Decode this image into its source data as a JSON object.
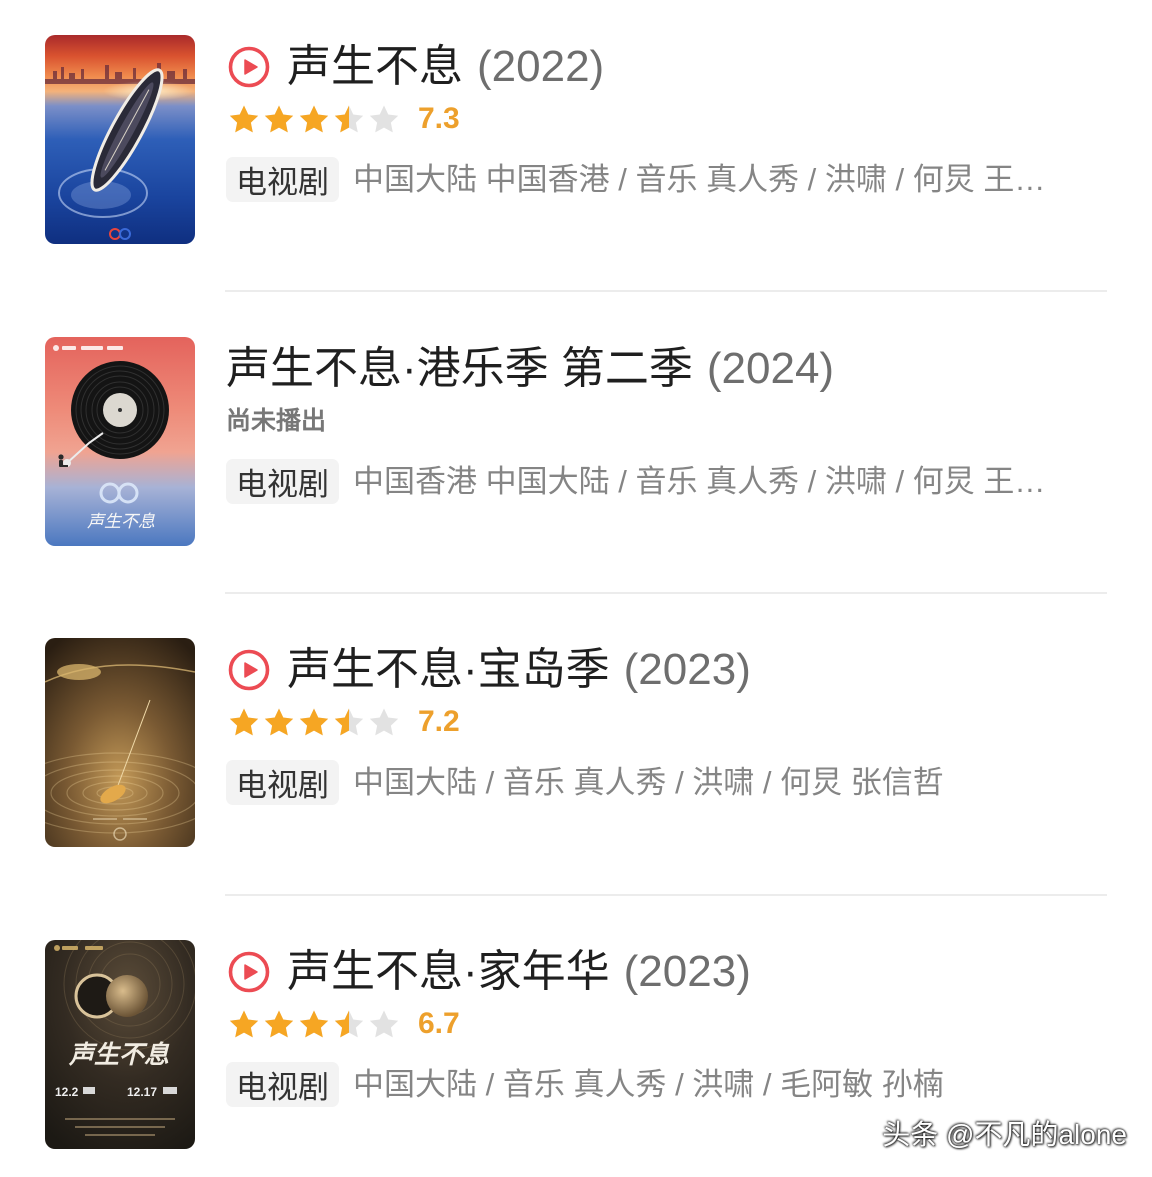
{
  "items": [
    {
      "icon": "play-circle-icon",
      "title": "声生不息",
      "year": "(2022)",
      "stars": 3.5,
      "rating": "7.3",
      "tag": "电视剧",
      "meta": "中国大陆 中国香港 / 音乐 真人秀 / 洪啸 / 何炅 王…"
    },
    {
      "title": "声生不息·港乐季 第二季",
      "year": "(2024)",
      "status": "尚未播出",
      "tag": "电视剧",
      "meta": "中国香港 中国大陆 / 音乐 真人秀 / 洪啸 / 何炅 王…",
      "poster_text": "声生不息"
    },
    {
      "icon": "play-circle-icon",
      "title": "声生不息·宝岛季",
      "year": "(2023)",
      "stars": 3.5,
      "rating": "7.2",
      "tag": "电视剧",
      "meta": "中国大陆 / 音乐 真人秀 / 洪啸 / 何炅 张信哲"
    },
    {
      "icon": "play-circle-icon",
      "title": "声生不息·家年华",
      "year": "(2023)",
      "stars": 3.5,
      "rating": "6.7",
      "tag": "电视剧",
      "meta": "中国大陆 / 音乐 真人秀 / 洪啸 / 毛阿敏 孙楠",
      "poster_text": "声生不息",
      "poster_dates": [
        "12.2",
        "12.17"
      ]
    }
  ],
  "watermark": "头条 @不凡的alone",
  "colors": {
    "play": "#ec4b53",
    "star_on": "#f6a623",
    "star_off": "#e2e2e2",
    "rating": "#eda02c",
    "title": "#1f1f1f",
    "year": "#6e6e6e",
    "meta": "#858585",
    "status": "#777777",
    "tag_bg": "#f3f3f3",
    "tag_text": "#333333",
    "divider": "#ececec",
    "bg": "#ffffff"
  }
}
